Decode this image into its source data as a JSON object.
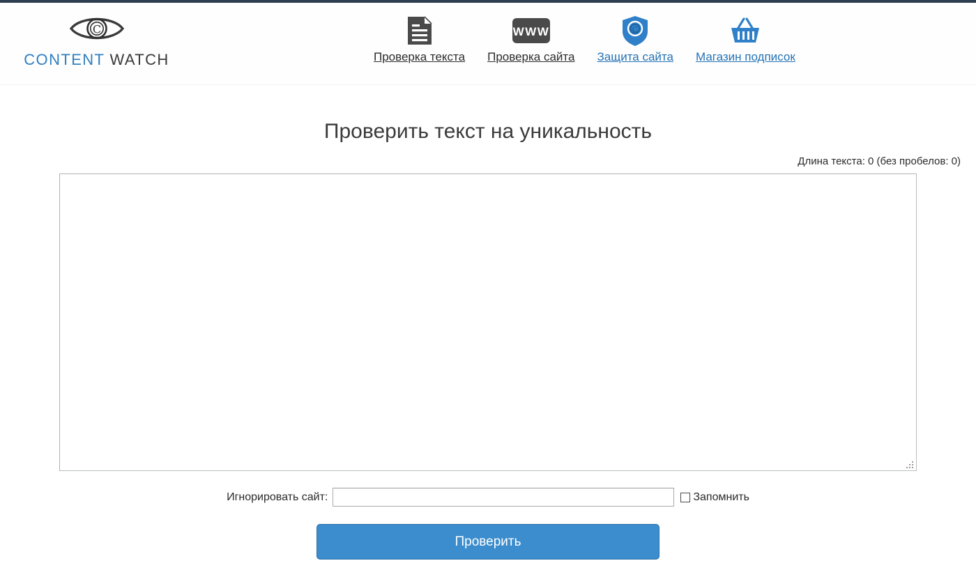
{
  "theme": {
    "top_strip_color": "#2c3e50",
    "brand_blue": "#2f7fc1",
    "link_blue": "#2472b5",
    "button_bg": "#3c8dcd",
    "button_border": "#2a6ea8",
    "text_dark": "#2b2b2b"
  },
  "header": {
    "logo": {
      "icon": "eye-copyright-icon",
      "word1": "CONTENT",
      "word2": " WATCH"
    },
    "nav": [
      {
        "label": "Проверка текста",
        "icon": "document-icon",
        "style": "dark"
      },
      {
        "label": "Проверка сайта",
        "icon": "www-icon",
        "style": "dark"
      },
      {
        "label": "Защита сайта",
        "icon": "shield-copyright-icon",
        "style": "blue"
      },
      {
        "label": "Магазин подписок",
        "icon": "shopping-basket-icon",
        "style": "blue"
      }
    ]
  },
  "main": {
    "title": "Проверить текст на уникальность",
    "counter": "Длина текста: 0 (без пробелов: 0)",
    "textarea": {
      "value": "",
      "placeholder": ""
    },
    "ignore_site": {
      "label": "Игнорировать сайт:",
      "value": "",
      "placeholder": ""
    },
    "remember": {
      "label": "Запомнить",
      "checked": false
    },
    "submit_label": "Проверить"
  }
}
